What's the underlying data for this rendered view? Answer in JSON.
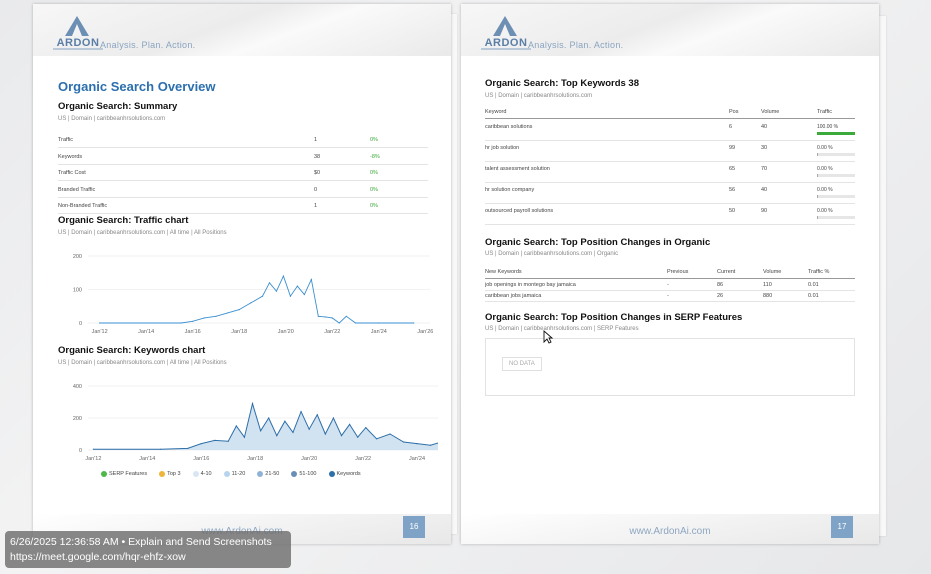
{
  "brand": {
    "logo_text": "ARDON",
    "tagline": "Analysis. Plan. Action."
  },
  "left_page": {
    "heading": "Organic Search Overview",
    "summary": {
      "title": "Organic Search: Summary",
      "subtitle": "US | Domain | caribbeanhrsolutions.com",
      "rows": [
        {
          "label": "Traffic",
          "value": "1",
          "change": "0%"
        },
        {
          "label": "Keywords",
          "value": "38",
          "change": "-8%"
        },
        {
          "label": "Traffic Cost",
          "value": "$0",
          "change": "0%"
        },
        {
          "label": "Branded Traffic",
          "value": "0",
          "change": "0%"
        },
        {
          "label": "Non-Branded Traffic",
          "value": "1",
          "change": "0%"
        }
      ]
    },
    "traffic_chart": {
      "title": "Organic Search: Traffic chart",
      "subtitle": "US | Domain | caribbeanhrsolutions.com | All time | All Positions"
    },
    "keywords_chart": {
      "title": "Organic Search: Keywords chart",
      "subtitle": "US | Domain | caribbeanhrsolutions.com | All time | All Positions"
    },
    "footer_url": "www.ArdonAi.com",
    "page_number": "16"
  },
  "right_page": {
    "top_keywords": {
      "title": "Organic Search: Top Keywords 38",
      "subtitle": "US | Domain | caribbeanhrsolutions.com",
      "headers": [
        "Keyword",
        "Pos",
        "Volume",
        "Traffic"
      ],
      "rows": [
        {
          "keyword": "caribbean solutions",
          "pos": "6",
          "volume": "40",
          "traffic": "100.00 %",
          "fill": 1.0
        },
        {
          "keyword": "hr job solution",
          "pos": "99",
          "volume": "30",
          "traffic": "0.00 %",
          "fill": 0.0
        },
        {
          "keyword": "talent assessment solution",
          "pos": "65",
          "volume": "70",
          "traffic": "0.00 %",
          "fill": 0.0
        },
        {
          "keyword": "hr solution company",
          "pos": "56",
          "volume": "40",
          "traffic": "0.00 %",
          "fill": 0.0
        },
        {
          "keyword": "outsourced payroll solutions",
          "pos": "50",
          "volume": "90",
          "traffic": "0.00 %",
          "fill": 0.0
        }
      ]
    },
    "position_changes": {
      "title": "Organic Search: Top Position Changes in Organic",
      "subtitle": "US | Domain | caribbeanhrsolutions.com | Organic",
      "headers": [
        "New Keywords",
        "Previous",
        "Current",
        "Volume",
        "Traffic %"
      ],
      "rows": [
        {
          "keyword": "job openings in montego bay jamaica",
          "previous": "-",
          "current": "86",
          "volume": "110",
          "traffic": "0.01"
        },
        {
          "keyword": "caribbean jobs jamaica",
          "previous": "-",
          "current": "26",
          "volume": "880",
          "traffic": "0.01"
        }
      ]
    },
    "serp_features": {
      "title": "Organic Search: Top Position Changes in SERP Features",
      "subtitle": "US | Domain | caribbeanhrsolutions.com | SERP Features",
      "no_data": "NO DATA"
    },
    "footer_url": "www.ArdonAi.com",
    "page_number": "17"
  },
  "chart_data": [
    {
      "type": "line",
      "title": "Organic Search: Traffic chart",
      "x_ticks": [
        "Jan'12",
        "Jan'14",
        "Jan'16",
        "Jan'18",
        "Jan'20",
        "Jan'22",
        "Jan'24",
        "Jan'26"
      ],
      "y_ticks": [
        0,
        100,
        200
      ],
      "ylim": [
        0,
        200
      ],
      "x": [
        2012.0,
        2015.5,
        2016.0,
        2016.5,
        2017.0,
        2017.5,
        2018.0,
        2018.5,
        2019.0,
        2019.3,
        2019.6,
        2019.9,
        2020.2,
        2020.5,
        2020.8,
        2021.1,
        2021.4,
        2021.7,
        2022.0,
        2022.3,
        2022.6,
        2023.0,
        2024.0,
        2025.5
      ],
      "series": [
        {
          "values": [
            0,
            0,
            5,
            15,
            20,
            30,
            40,
            60,
            80,
            120,
            95,
            140,
            80,
            110,
            85,
            130,
            20,
            18,
            15,
            0,
            20,
            0,
            0,
            0
          ]
        }
      ],
      "color": "#3a8fd0"
    },
    {
      "type": "area",
      "title": "Organic Search: Keywords chart",
      "x_ticks": [
        "Jan'12",
        "Jan'14",
        "Jan'16",
        "Jan'18",
        "Jan'20",
        "Jan'22",
        "Jan'24"
      ],
      "y_ticks": [
        0,
        200,
        400
      ],
      "ylim": [
        0,
        400
      ],
      "x": [
        2012.0,
        2014.5,
        2015.5,
        2016.0,
        2016.5,
        2017.0,
        2017.3,
        2017.6,
        2017.9,
        2018.2,
        2018.5,
        2018.8,
        2019.1,
        2019.4,
        2019.7,
        2020.0,
        2020.3,
        2020.6,
        2020.9,
        2021.2,
        2021.5,
        2021.8,
        2022.1,
        2022.5,
        2023.0,
        2023.5,
        2024.0,
        2024.5,
        2024.9
      ],
      "series": [
        {
          "name": "Keywords",
          "values": [
            5,
            5,
            10,
            40,
            60,
            55,
            150,
            80,
            290,
            120,
            200,
            90,
            180,
            110,
            240,
            130,
            220,
            100,
            200,
            90,
            160,
            80,
            140,
            70,
            100,
            50,
            40,
            30,
            50
          ]
        }
      ],
      "legend": [
        "SERP Features",
        "Top 3",
        "4-10",
        "11-20",
        "21-50",
        "51-100",
        "Keywords"
      ],
      "legend_colors": [
        "#4db848",
        "#f0b43a",
        "#d8e6f3",
        "#b8d4ec",
        "#8fb3d6",
        "#6a8fb5",
        "#2d6fa8"
      ],
      "legend_position": "bottom"
    }
  ],
  "overlay": {
    "line1": "6/26/2025 12:36:58 AM • Explain and Send Screenshots",
    "line2": "https://meet.google.com/hqr-ehfz-xow"
  }
}
